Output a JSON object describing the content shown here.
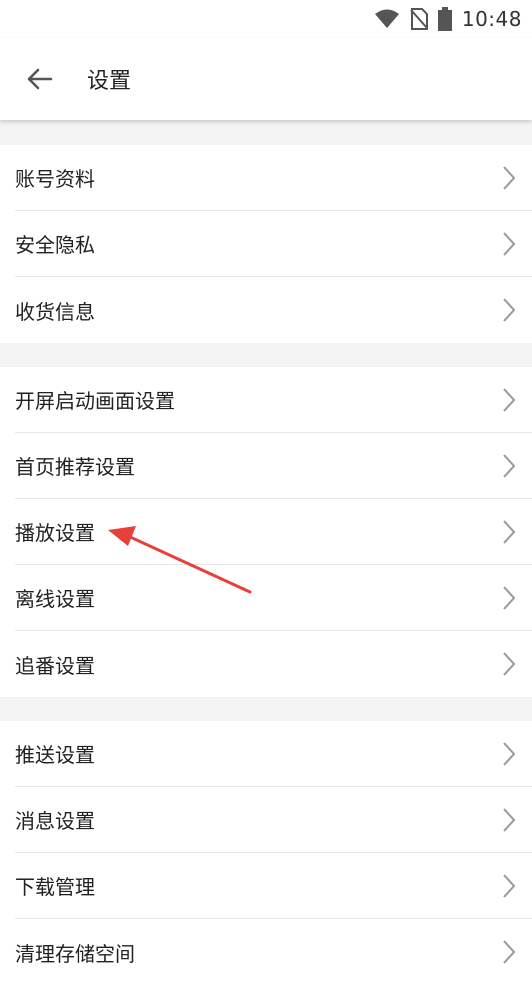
{
  "status_bar": {
    "time": "10:48"
  },
  "header": {
    "title": "设置"
  },
  "groups": [
    {
      "items": [
        {
          "label": "账号资料"
        },
        {
          "label": "安全隐私"
        },
        {
          "label": "收货信息"
        }
      ]
    },
    {
      "items": [
        {
          "label": "开屏启动画面设置"
        },
        {
          "label": "首页推荐设置"
        },
        {
          "label": "播放设置"
        },
        {
          "label": "离线设置"
        },
        {
          "label": "追番设置"
        }
      ]
    },
    {
      "items": [
        {
          "label": "推送设置"
        },
        {
          "label": "消息设置"
        },
        {
          "label": "下载管理"
        },
        {
          "label": "清理存储空间"
        }
      ]
    }
  ],
  "colors": {
    "annotation_arrow": "#e8403a"
  }
}
